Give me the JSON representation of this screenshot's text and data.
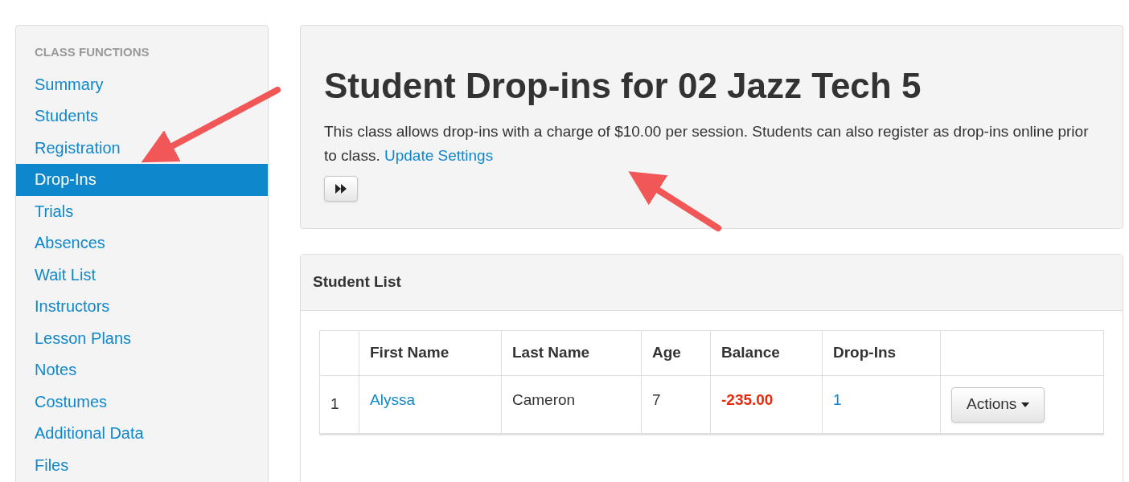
{
  "sidebar": {
    "heading": "CLASS FUNCTIONS",
    "items": [
      {
        "label": "Summary",
        "selected": false
      },
      {
        "label": "Students",
        "selected": false
      },
      {
        "label": "Registration",
        "selected": false
      },
      {
        "label": "Drop-Ins",
        "selected": true
      },
      {
        "label": "Trials",
        "selected": false
      },
      {
        "label": "Absences",
        "selected": false
      },
      {
        "label": "Wait List",
        "selected": false
      },
      {
        "label": "Instructors",
        "selected": false
      },
      {
        "label": "Lesson Plans",
        "selected": false
      },
      {
        "label": "Notes",
        "selected": false
      },
      {
        "label": "Costumes",
        "selected": false
      },
      {
        "label": "Additional Data",
        "selected": false
      },
      {
        "label": "Files",
        "selected": false
      }
    ]
  },
  "header": {
    "title": "Student Drop-ins for 02 Jazz Tech 5",
    "description": "This class allows drop-ins with a charge of $10.00 per session. Students can also register as drop-ins online prior to class.",
    "link": "Update Settings"
  },
  "student_list": {
    "title": "Student List",
    "columns": [
      "First Name",
      "Last Name",
      "Age",
      "Balance",
      "Drop-Ins"
    ],
    "rows": [
      {
        "number": "1",
        "first_name": "Alyssa",
        "last_name": "Cameron",
        "age": "7",
        "balance": "-235.00",
        "drop_ins": "1",
        "action": "Actions"
      }
    ]
  }
}
